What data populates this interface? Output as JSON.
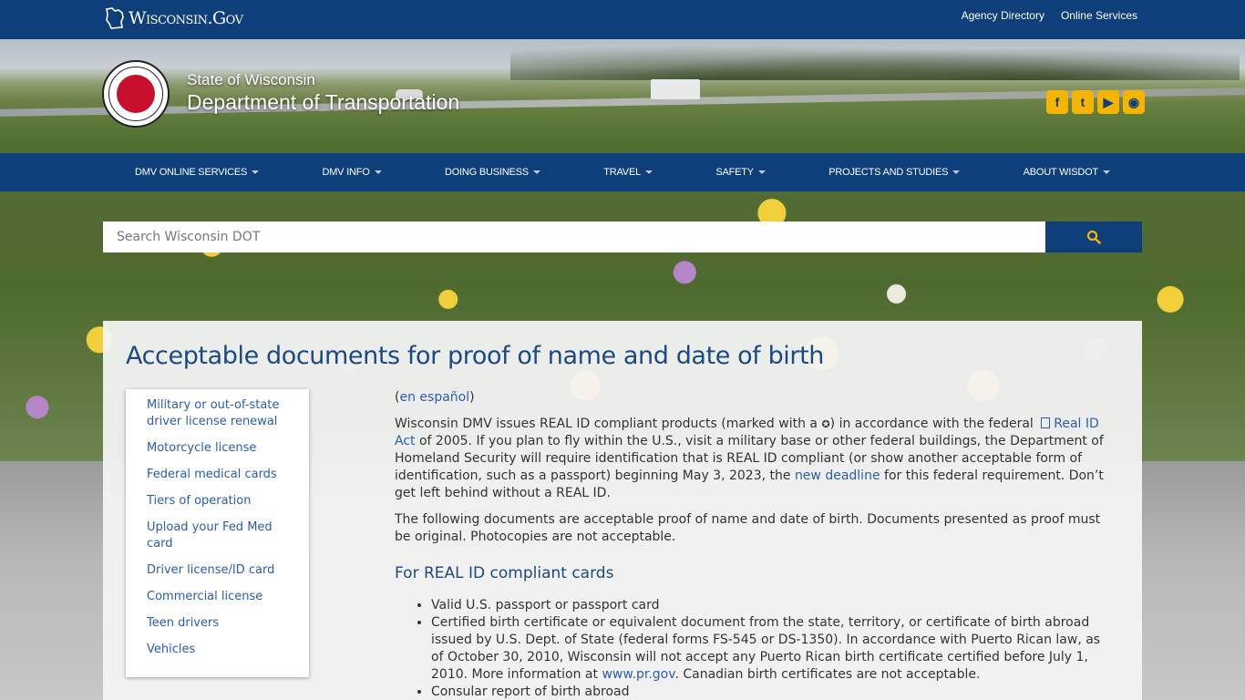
{
  "topbar": {
    "logo_text": "Wisconsin.Gov",
    "links": [
      "Agency Directory",
      "Online Services"
    ]
  },
  "banner": {
    "state_name": "State of Wisconsin",
    "department_name": "Department of Transportation",
    "social": [
      "facebook-icon",
      "twitter-icon",
      "youtube-icon",
      "podcast-icon"
    ]
  },
  "nav": {
    "items": [
      "DMV ONLINE SERVICES",
      "DMV INFO",
      "DOING BUSINESS",
      "TRAVEL",
      "SAFETY",
      "PROJECTS AND STUDIES",
      "ABOUT WISDOT"
    ]
  },
  "search": {
    "placeholder": "Search Wisconsin DOT"
  },
  "page": {
    "title": "Acceptable documents for proof of name and date of birth"
  },
  "sidenav": {
    "items": [
      "Military or out-of-state driver license renewal",
      "Motorcycle license",
      "Federal medical cards",
      "Tiers of operation",
      "Upload your Fed Med card",
      "Driver license/ID card",
      "Commercial license",
      "Teen drivers",
      "Vehicles"
    ]
  },
  "main": {
    "spanish_link": "en español",
    "intro_1": "Wisconsin DMV issues REAL ID compliant products (marked with a ",
    "intro_star": "✪",
    "intro_2": ") in accordance with the federal ",
    "real_id_act_link": "Real ID Act",
    "intro_3": " of 2005. If you plan to fly within the U.S., visit a military base or other federal buildings, the Department of Homeland Security will require identification that is REAL ID compliant (or show another acceptable form of identification, such as a passport) beginning May 3, 2023, the ",
    "new_deadline_link": "new deadline",
    "intro_4": " for this federal requirement. Don’t get left behind without a REAL ID.",
    "para_2": "The following documents are acceptable proof of name and date of birth. Documents presented as proof must be original. Photocopies are not acceptable.",
    "section_heading": "For REAL ID compliant cards",
    "list_1": "Valid U.S. passport or passport card",
    "list_2_text": "Certified birth certificate or equivalent document from the state, territory, or certificate of birth abroad issued by U.S. Dept. of State (federal forms FS-545 or DS-1350). In accordance with Puerto Rican law, as of October 30, 2010, Wisconsin will not accept any Puerto Rican birth certificate certified before July 1, 2010. More information at ",
    "list_2_link": "www.pr.gov",
    "list_2_end": ". Canadian birth certificates are not acceptable.",
    "list_3": "Consular report of birth abroad"
  }
}
